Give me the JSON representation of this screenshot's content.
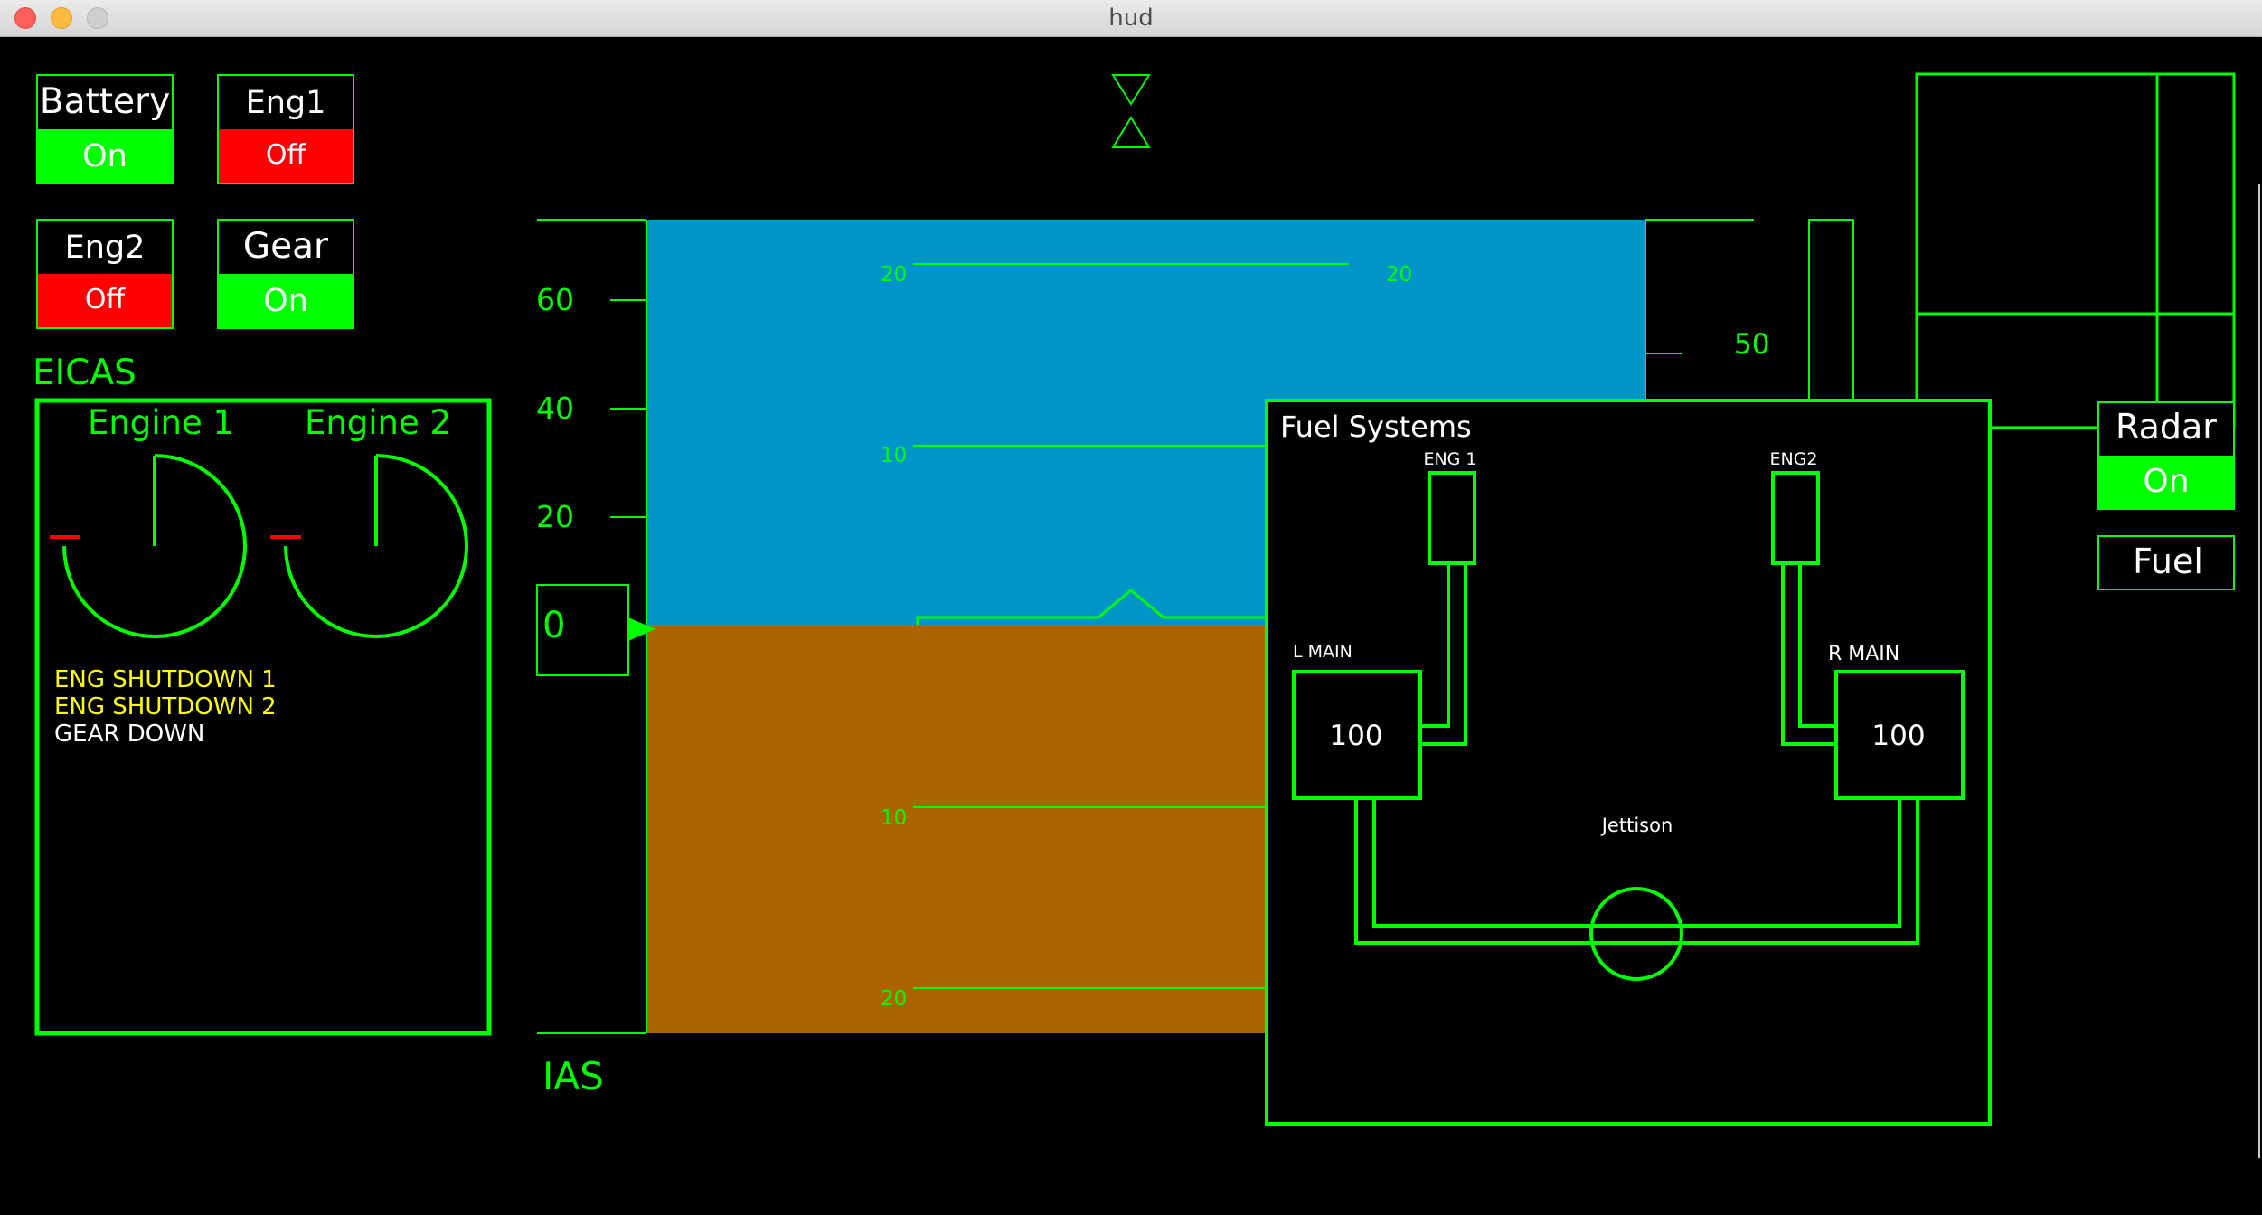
{
  "window": {
    "title": "hud"
  },
  "toggles": [
    {
      "label": "Battery",
      "state": "On",
      "color": "#00ff00"
    },
    {
      "label": "Eng1",
      "state": "Off",
      "color": "#ff0000"
    },
    {
      "label": "Eng2",
      "state": "Off",
      "color": "#ff0000"
    },
    {
      "label": "Gear",
      "state": "On",
      "color": "#00ff00"
    }
  ],
  "eicas": {
    "title": "EICAS",
    "engine1_label": "Engine 1",
    "engine2_label": "Engine 2",
    "messages": [
      {
        "text": "ENG SHUTDOWN 1",
        "color": "#ffff00"
      },
      {
        "text": "ENG SHUTDOWN 2",
        "color": "#ffff00"
      },
      {
        "text": "GEAR DOWN",
        "color": "#ffffff"
      }
    ]
  },
  "ias": {
    "label": "IAS",
    "ticks": [
      "60",
      "40",
      "20"
    ],
    "current": "0"
  },
  "pitch_ladder": {
    "upper": [
      "20",
      "10"
    ],
    "upper_right": "20",
    "lower": [
      "10",
      "20"
    ]
  },
  "altitude": {
    "tick": "50"
  },
  "fuel_systems": {
    "title": "Fuel Systems",
    "eng1_label": "ENG 1",
    "eng2_label": "ENG2",
    "l_main_label": "L MAIN",
    "r_main_label": "R MAIN",
    "l_main_value": "100",
    "r_main_value": "100",
    "jettison_label": "Jettison"
  },
  "side_buttons": {
    "radar_label": "Radar",
    "radar_state": "On",
    "fuel_label": "Fuel"
  },
  "colors": {
    "hud_green": "#00ff00",
    "sky": "#0095c8",
    "ground": "#aa6400",
    "off_red": "#ff0000"
  }
}
